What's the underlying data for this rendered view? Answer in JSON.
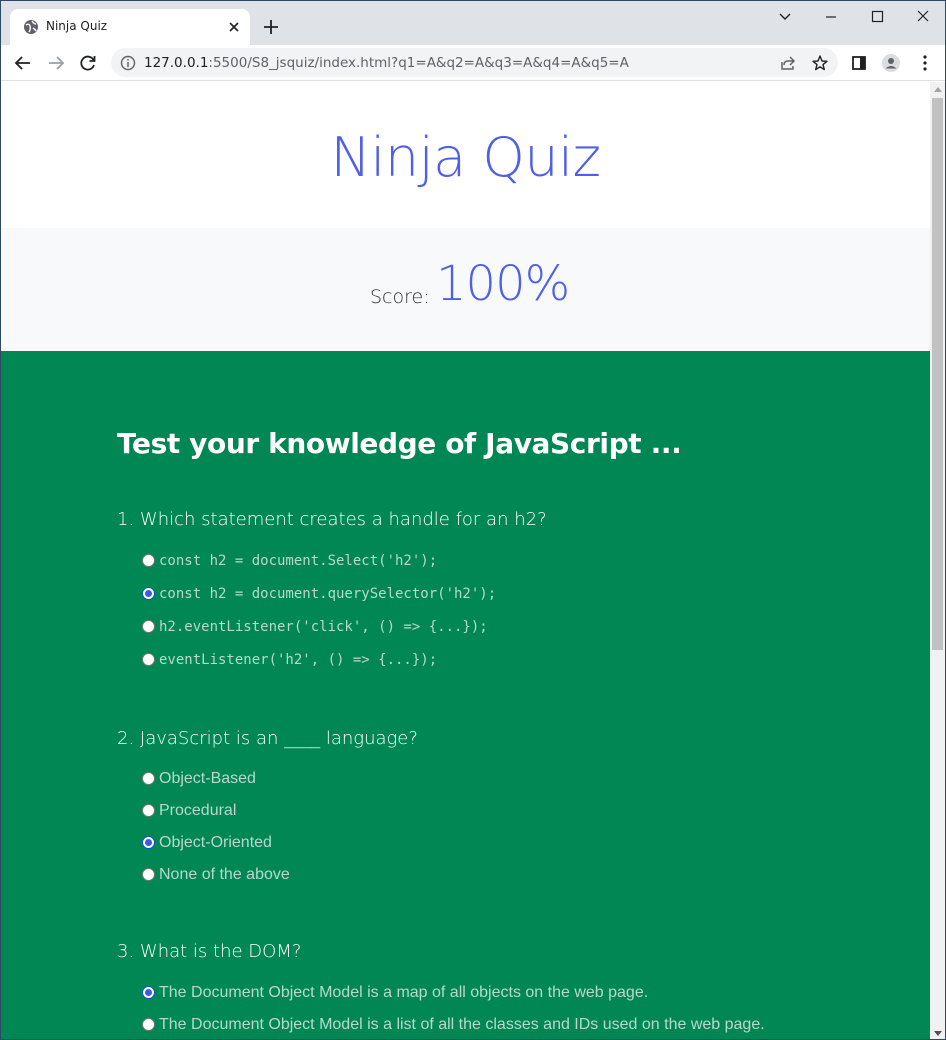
{
  "browser": {
    "tab_title": "Ninja Quiz",
    "url_host": "127.0.0.1",
    "url_rest": ":5500/S8_jsquiz/index.html?q1=A&q2=A&q3=A&q4=A&q5=A"
  },
  "page": {
    "title": "Ninja Quiz",
    "score_label": "Score:",
    "score_value": "100%",
    "quiz_heading": "Test your knowledge of JavaScript ...",
    "accent_color": "#4f5fe6",
    "quiz_bg_color": "#008754"
  },
  "questions": [
    {
      "text": "1. Which statement creates a handle for an h2?",
      "options": [
        {
          "label": "const h2 = document.Select('h2');",
          "checked": false
        },
        {
          "label": "const h2 = document.querySelector('h2');",
          "checked": true
        },
        {
          "label": "h2.eventListener('click', () => {...});",
          "checked": false
        },
        {
          "label": "eventListener('h2', () => {...});",
          "checked": false
        }
      ]
    },
    {
      "text": "2. JavaScript is an ____ language?",
      "options": [
        {
          "label": "Object-Based",
          "checked": false
        },
        {
          "label": "Procedural",
          "checked": false
        },
        {
          "label": "Object-Oriented",
          "checked": true
        },
        {
          "label": "None of the above",
          "checked": false
        }
      ]
    },
    {
      "text": "3. What is the DOM?",
      "options": [
        {
          "label": "The Document Object Model is a map of all objects on the web page.",
          "checked": true
        },
        {
          "label": "The Document Object Model is a list of all the classes and IDs used on the web page.",
          "checked": false
        }
      ]
    }
  ]
}
